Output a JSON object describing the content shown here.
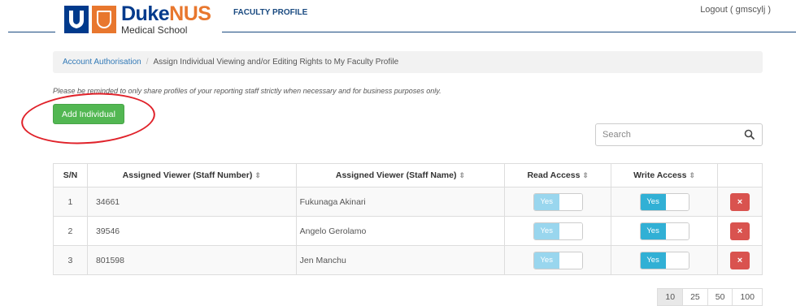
{
  "header": {
    "logo_main_1": "Duke",
    "logo_main_2": "NUS",
    "logo_sub": "Medical School",
    "app_title": "FACULTY PROFILE",
    "logout": "Logout ( gmscylj )"
  },
  "breadcrumb": {
    "link": "Account Authorisation",
    "separator": "/",
    "current": "Assign Individual Viewing and/or Editing Rights to My Faculty Profile"
  },
  "notice": "Please be reminded to only share profiles of your reporting staff strictly when necessary and for business purposes only.",
  "add_button": "Add Individual",
  "search": {
    "placeholder": "Search"
  },
  "table": {
    "headers": {
      "sn": "S/N",
      "staff_number": "Assigned Viewer (Staff Number)",
      "staff_name": "Assigned Viewer (Staff Name)",
      "read": "Read Access",
      "write": "Write Access"
    },
    "sort_glyph": "⇕",
    "rows": [
      {
        "sn": "1",
        "number": "34661",
        "name": "Fukunaga Akinari",
        "read": "Yes",
        "write": "Yes",
        "delete": "×"
      },
      {
        "sn": "2",
        "number": "39546",
        "name": "Angelo Gerolamo",
        "read": "Yes",
        "write": "Yes",
        "delete": "×"
      },
      {
        "sn": "3",
        "number": "801598",
        "name": "Jen Manchu",
        "read": "Yes",
        "write": "Yes",
        "delete": "×"
      }
    ]
  },
  "pagination": {
    "sizes": [
      "10",
      "25",
      "50",
      "100"
    ],
    "active": "10"
  },
  "colors": {
    "brand_blue": "#003a8c",
    "brand_orange": "#e8772e",
    "add_green": "#52b752",
    "delete_red": "#d9534f",
    "toggle_on": "#31b0d5",
    "annotation_red": "#e0222a"
  }
}
